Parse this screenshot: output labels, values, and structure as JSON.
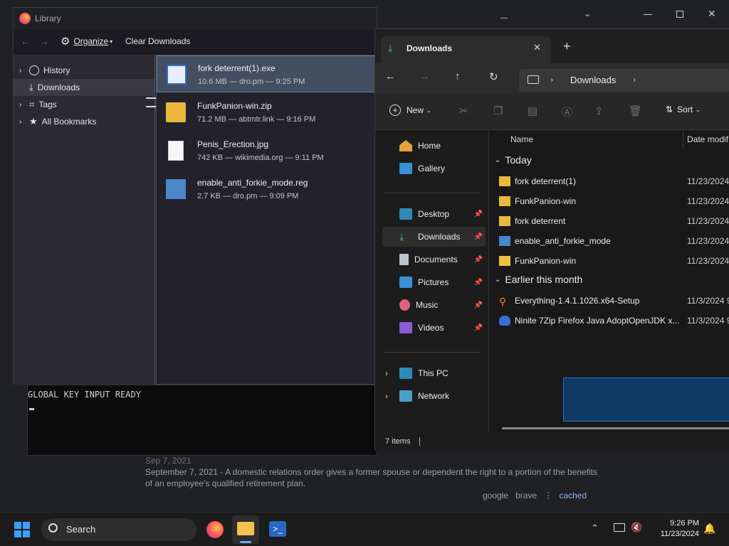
{
  "background": {
    "snippet_date": "Sep 7, 2021",
    "snippet_text": "September 7, 2021 - A domestic relations order gives a former spouse or dependent the right to a portion of the benefits of an employee's qualified retirement plan.",
    "link_google": "google",
    "link_brave": "brave",
    "link_sep": "⋮",
    "link_cached": "cached"
  },
  "console": {
    "text": "GLOBAL KEY INPUT READY"
  },
  "library": {
    "title": "Library",
    "organize_label": "Organize",
    "clear_label": "Clear Downloads",
    "sidebar": [
      {
        "label": "History"
      },
      {
        "label": "Downloads"
      },
      {
        "label": "Tags"
      },
      {
        "label": "All Bookmarks"
      }
    ],
    "downloads": [
      {
        "name": "fork deterrent(1).exe",
        "meta": "10.6 MB — dro.pm — 9:25 PM"
      },
      {
        "name": "FunkPanion-win.zip",
        "meta": "71.2 MB — abtmtr.link — 9:16 PM"
      },
      {
        "name": "Penis_Erection.jpg",
        "meta": "742 KB — wikimedia.org — 9:11 PM"
      },
      {
        "name": "enable_anti_forkie_mode.reg",
        "meta": "2.7 KB — dro.pm — 9:09 PM"
      }
    ]
  },
  "explorer": {
    "tab_title": "Downloads",
    "address": "Downloads",
    "new_label": "New",
    "sort_label": "Sort",
    "col_name": "Name",
    "col_date": "Date modif",
    "nav": [
      {
        "label": "Home"
      },
      {
        "label": "Gallery"
      },
      {
        "label": "Desktop"
      },
      {
        "label": "Downloads"
      },
      {
        "label": "Documents"
      },
      {
        "label": "Pictures"
      },
      {
        "label": "Music"
      },
      {
        "label": "Videos"
      },
      {
        "label": "This PC"
      },
      {
        "label": "Network"
      }
    ],
    "group_today": "Today",
    "group_earlier": "Earlier this month",
    "files_today": [
      {
        "name": "fork deterrent(1)",
        "date": "11/23/2024"
      },
      {
        "name": "FunkPanion-win",
        "date": "11/23/2024"
      },
      {
        "name": "fork deterrent",
        "date": "11/23/2024"
      },
      {
        "name": "enable_anti_forkie_mode",
        "date": "11/23/2024"
      },
      {
        "name": "FunkPanion-win",
        "date": "11/23/2024"
      }
    ],
    "files_earlier": [
      {
        "name": "Everything-1.4.1.1026.x64-Setup",
        "date": "11/3/2024 9"
      },
      {
        "name": "Ninite 7Zip Firefox Java AdoptOpenJDK x...",
        "date": "11/3/2024 9"
      }
    ],
    "status": "7 items"
  },
  "taskbar": {
    "search_label": "Search",
    "time": "9:26 PM",
    "date": "11/23/2024"
  }
}
